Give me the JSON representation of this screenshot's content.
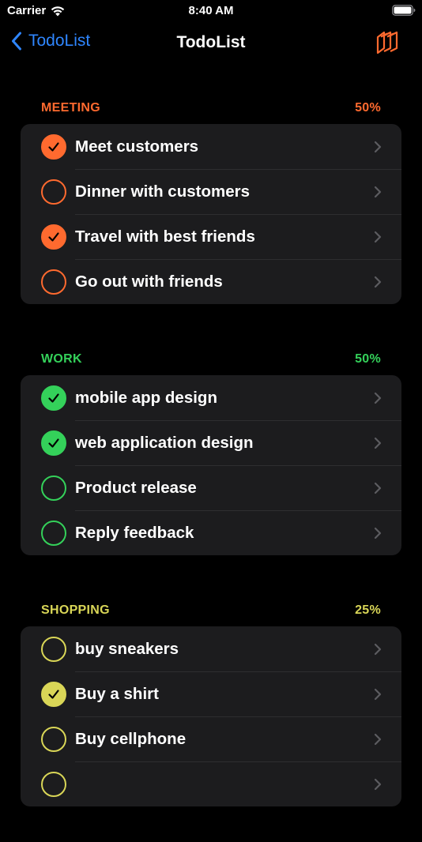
{
  "status_bar": {
    "carrier": "Carrier",
    "time": "8:40 AM",
    "icons": [
      "wifi-icon",
      "battery-icon"
    ]
  },
  "nav": {
    "back_label": "TodoList",
    "title": "TodoList",
    "back_color": "#2f86ff",
    "action_icon": "stacked-cards-icon",
    "action_color": "#ff6a2f"
  },
  "sections": [
    {
      "name": "MEETING",
      "percent": "50%",
      "color": "#ff6a2f",
      "items": [
        {
          "label": "Meet customers",
          "done": true
        },
        {
          "label": "Dinner with customers",
          "done": false
        },
        {
          "label": "Travel with best friends",
          "done": true
        },
        {
          "label": "Go out with friends",
          "done": false
        }
      ]
    },
    {
      "name": "WORK",
      "percent": "50%",
      "color": "#34d15a",
      "items": [
        {
          "label": "mobile app design",
          "done": true
        },
        {
          "label": "web application design",
          "done": true
        },
        {
          "label": "Product release",
          "done": false
        },
        {
          "label": "Reply feedback",
          "done": false
        }
      ]
    },
    {
      "name": "SHOPPING",
      "percent": "25%",
      "color": "#d9d657",
      "items": [
        {
          "label": "buy sneakers",
          "done": false
        },
        {
          "label": "Buy a shirt",
          "done": true
        },
        {
          "label": "Buy cellphone",
          "done": false
        },
        {
          "label": "",
          "done": false
        }
      ]
    }
  ]
}
